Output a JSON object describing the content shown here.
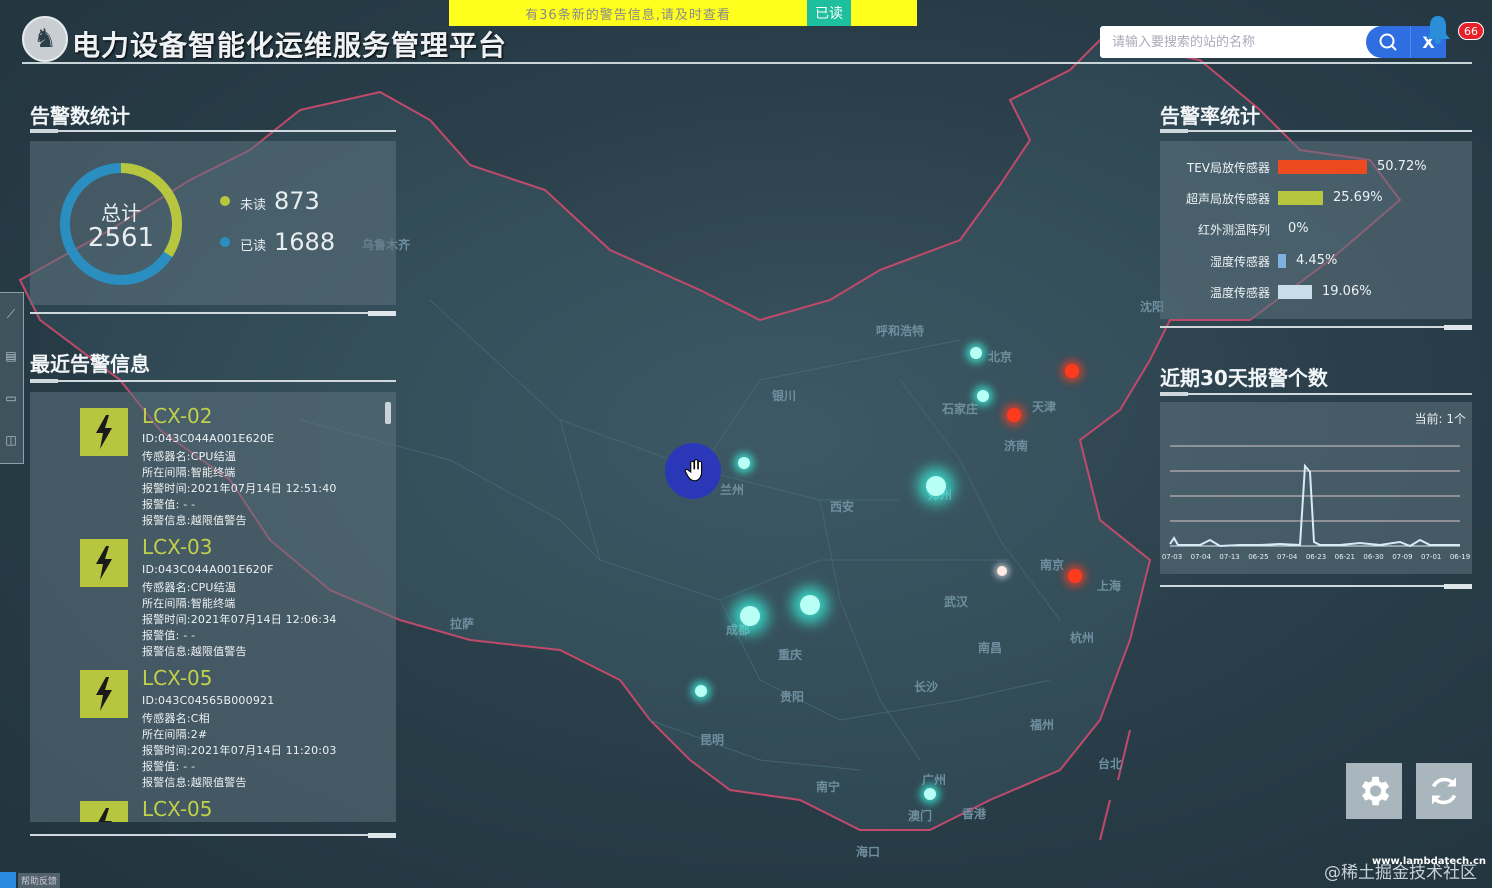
{
  "banner": {
    "message": "有36条新的警告信息,请及时查看",
    "read_button": "已读"
  },
  "header": {
    "title": "电力设备智能化运维服务管理平台",
    "search_placeholder": "请输入要搜索的站的名称",
    "clear_button": "X",
    "notification_count": "66"
  },
  "alarm_count": {
    "title": "告警数统计",
    "total_label": "总计",
    "total_value": "2561",
    "unread_label": "未读",
    "unread_value": "873",
    "read_label": "已读",
    "read_value": "1688",
    "colors": {
      "unread": "#b7c63e",
      "read": "#2a8fc0"
    }
  },
  "recent_alarms": {
    "title": "最近告警信息",
    "items": [
      {
        "name": "LCX-02",
        "id": "ID:043C044A001E620E",
        "sensor": "传感器名:CPU结温",
        "room": "所在间隔:智能终端",
        "time": "报警时间:2021年07月14日 12:51:40",
        "value": "报警值: - -",
        "info": "报警信息:越限值警告"
      },
      {
        "name": "LCX-03",
        "id": "ID:043C044A001E620F",
        "sensor": "传感器名:CPU结温",
        "room": "所在间隔:智能终端",
        "time": "报警时间:2021年07月14日 12:06:34",
        "value": "报警值: - -",
        "info": "报警信息:越限值警告"
      },
      {
        "name": "LCX-05",
        "id": "ID:043C04565B000921",
        "sensor": "传感器名:C相",
        "room": "所在间隔:2#",
        "time": "报警时间:2021年07月14日 11:20:03",
        "value": "报警值: - -",
        "info": "报警信息:越限值警告"
      },
      {
        "name": "LCX-05",
        "id": "",
        "sensor": "",
        "room": "",
        "time": "",
        "value": "",
        "info": ""
      }
    ]
  },
  "alarm_rate": {
    "title": "告警率统计",
    "rows": [
      {
        "name": "TEV局放传感器",
        "value": "50.72%",
        "percent": 50.72,
        "color": "#ee4a22"
      },
      {
        "name": "超声局放传感器",
        "value": "25.69%",
        "percent": 25.69,
        "color": "#b7c63e"
      },
      {
        "name": "红外测温阵列",
        "value": "0%",
        "percent": 0,
        "color": "#8fb0c0"
      },
      {
        "name": "湿度传感器",
        "value": "4.45%",
        "percent": 4.45,
        "color": "#7fb0e0"
      },
      {
        "name": "温度传感器",
        "value": "19.06%",
        "percent": 19.06,
        "color": "#c8dde8"
      }
    ]
  },
  "recent30": {
    "title": "近期30天报警个数",
    "current_label": "当前: 1个",
    "x_labels": [
      "07-03",
      "07-04",
      "07-13",
      "06-25",
      "07-04",
      "06-23",
      "06-21",
      "06-30",
      "07-09",
      "07-01",
      "06-19"
    ]
  },
  "map": {
    "cities": [
      "北京",
      "天津",
      "石家庄",
      "济南",
      "呼和浩特",
      "银川",
      "兰州",
      "西安",
      "郑州",
      "南京",
      "上海",
      "杭州",
      "武汉",
      "成都",
      "重庆",
      "贵阳",
      "昆明",
      "长沙",
      "南昌",
      "福州",
      "台北",
      "广州",
      "澳门",
      "香港",
      "南宁",
      "海口",
      "拉萨",
      "乌鲁木齐",
      "沈阳"
    ]
  },
  "side_tools": [
    "chart-icon",
    "doc-icon",
    "monitor-icon",
    "device-icon"
  ],
  "footer": {
    "watermark": "@稀土掘金技术社区",
    "site": "www.lambdatech.cn",
    "corner_text": "帮助反馈"
  }
}
